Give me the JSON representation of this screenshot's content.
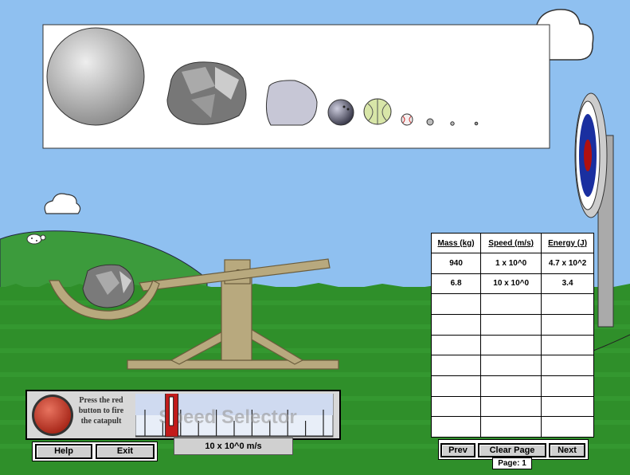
{
  "colors": {
    "sky": "#8fc0f0",
    "hill": "#3c9b3c",
    "grass": "#2f8f2a",
    "catapult": "#b8a97e",
    "red_button": "#c0392b",
    "target_blue": "#1a2fa0",
    "target_red": "#b01010"
  },
  "projectiles": [
    {
      "name": "stone-ball",
      "icon": "large-gray-sphere"
    },
    {
      "name": "boulder",
      "icon": "boulder-icon"
    },
    {
      "name": "rock",
      "icon": "rock-icon"
    },
    {
      "name": "bowling-ball",
      "icon": "bowling-ball-icon"
    },
    {
      "name": "melon",
      "icon": "melon-icon"
    },
    {
      "name": "baseball",
      "icon": "baseball-icon"
    },
    {
      "name": "marble",
      "icon": "marble-icon"
    },
    {
      "name": "pebble",
      "icon": "pebble-icon"
    },
    {
      "name": "bb",
      "icon": "bb-icon"
    }
  ],
  "table": {
    "headers": [
      "Mass (kg)",
      "Speed (m/s)",
      "Energy (J)"
    ],
    "rows": [
      [
        "940",
        "1 x 10^0",
        "4.7 x 10^2"
      ],
      [
        "6.8",
        "10 x 10^0",
        "3.4"
      ],
      [
        "",
        "",
        ""
      ],
      [
        "",
        "",
        ""
      ],
      [
        "",
        "",
        ""
      ],
      [
        "",
        "",
        ""
      ],
      [
        "",
        "",
        ""
      ],
      [
        "",
        "",
        ""
      ],
      [
        "",
        "",
        ""
      ]
    ]
  },
  "controls": {
    "instruction": "Press the red button to fire the catapult",
    "speed_selector_label": "Speed Selector",
    "speed_readout": "10 x 10^0 m/s",
    "speed_level": 0.15,
    "help_label": "Help",
    "exit_label": "Exit",
    "prev_label": "Prev",
    "clear_label": "Clear Page",
    "next_label": "Next",
    "page_label": "Page: 1"
  }
}
